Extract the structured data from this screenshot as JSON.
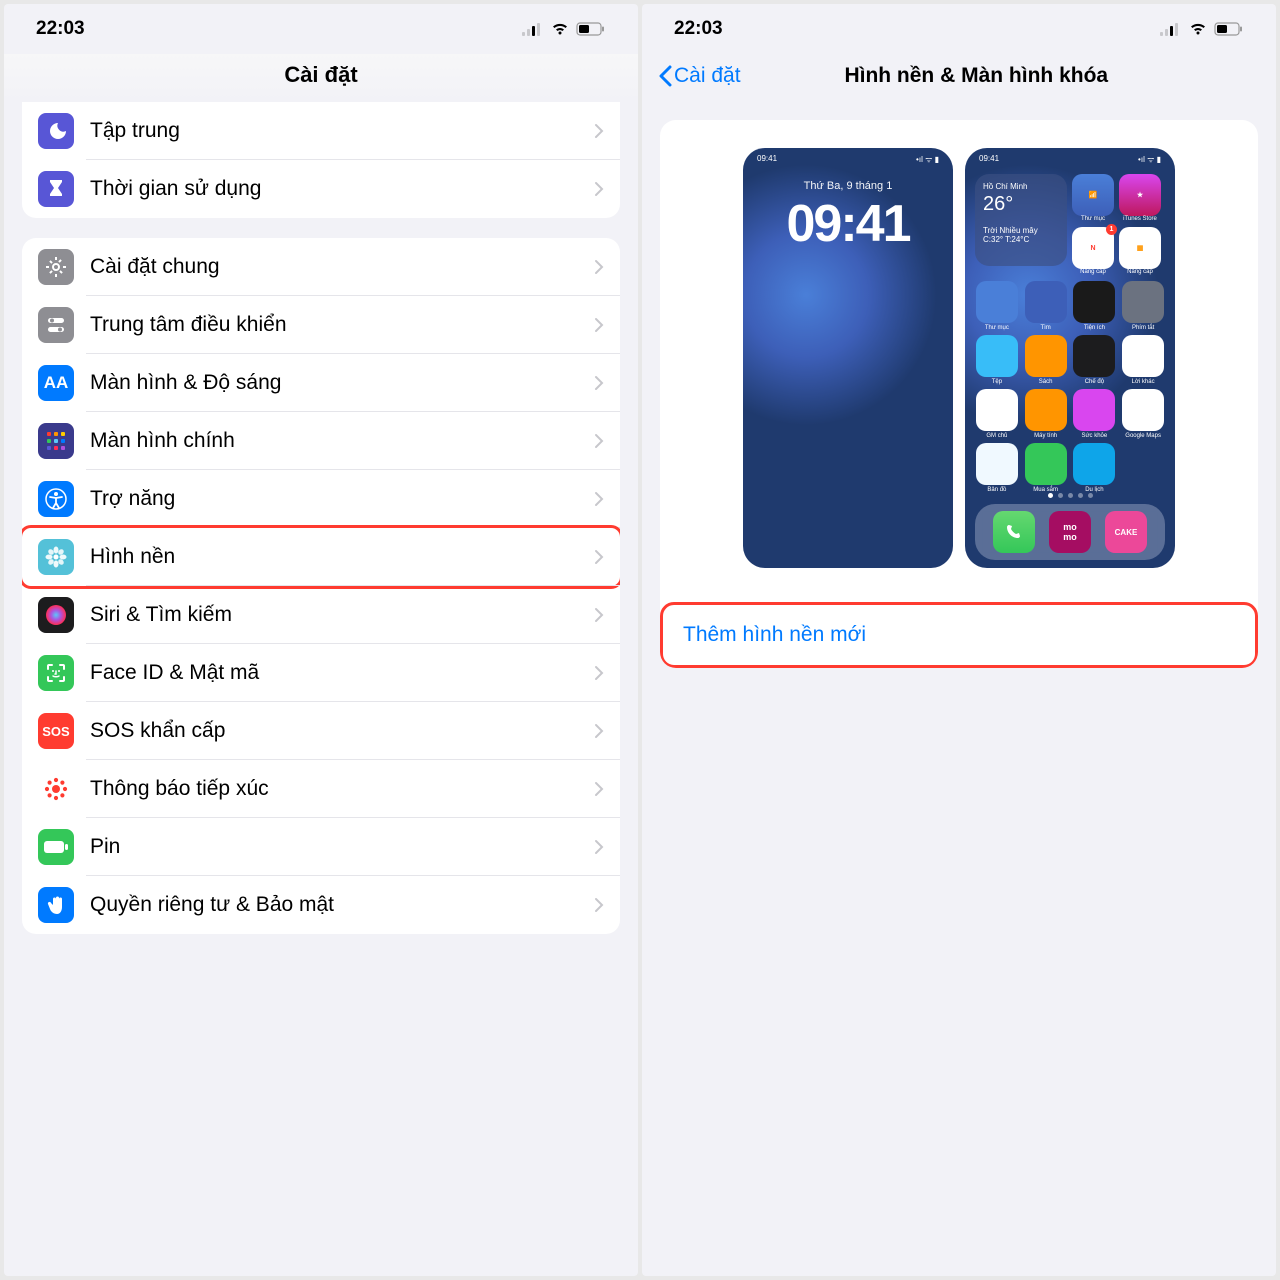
{
  "left": {
    "status_time": "22:03",
    "title": "Cài đặt",
    "group1": [
      {
        "icon": "moon",
        "bg": "#5856d6",
        "label": "Tập trung"
      },
      {
        "icon": "hourglass",
        "bg": "#5856d6",
        "label": "Thời gian sử dụng"
      }
    ],
    "group2": [
      {
        "icon": "gear",
        "bg": "#8e8e93",
        "label": "Cài đặt chung"
      },
      {
        "icon": "switches",
        "bg": "#8e8e93",
        "label": "Trung tâm điều khiển"
      },
      {
        "icon": "aa",
        "bg": "#007aff",
        "label": "Màn hình & Độ sáng"
      },
      {
        "icon": "grid",
        "bg": "#3a3a8c",
        "label": "Màn hình chính"
      },
      {
        "icon": "accessibility",
        "bg": "#007aff",
        "label": "Trợ năng"
      },
      {
        "icon": "flower",
        "bg": "#54c1d8",
        "label": "Hình nền",
        "highlighted": true
      },
      {
        "icon": "siri",
        "bg": "#1c1c1e",
        "label": "Siri & Tìm kiếm"
      },
      {
        "icon": "faceid",
        "bg": "#34c759",
        "label": "Face ID & Mật mã"
      },
      {
        "icon": "sos",
        "bg": "#ff3b30",
        "label": "SOS khẩn cấp"
      },
      {
        "icon": "exposure",
        "bg": "#ffffff",
        "label": "Thông báo tiếp xúc",
        "fg": "#ff3b30"
      },
      {
        "icon": "battery",
        "bg": "#34c759",
        "label": "Pin"
      },
      {
        "icon": "hand",
        "bg": "#007aff",
        "label": "Quyền riêng tư & Bảo mật"
      }
    ]
  },
  "right": {
    "status_time": "22:03",
    "back_label": "Cài đặt",
    "title": "Hình nền & Màn hình khóa",
    "lock": {
      "date": "Thứ Ba, 9 tháng 1",
      "time": "09:41"
    },
    "home": {
      "status_time": "09:41",
      "weather_city": "Hồ Chí Minh",
      "weather_temp": "26°",
      "weather_desc": "Trời Nhiều mây",
      "weather_range": "C:32° T:24°C"
    },
    "action": "Thêm hình nền mới"
  }
}
